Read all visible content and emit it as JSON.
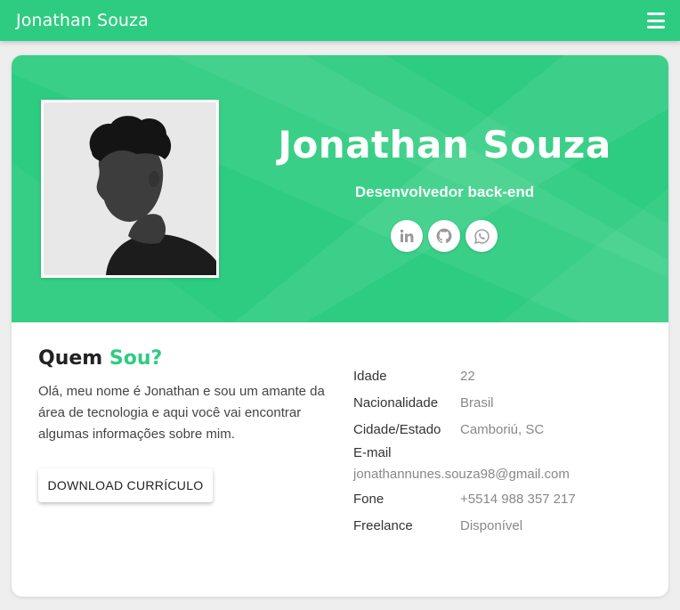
{
  "navbar": {
    "brand": "Jonathan Souza",
    "menu_icon": "hamburger-menu-icon"
  },
  "hero": {
    "name": "Jonathan Souza",
    "role": "Desenvolvedor back-end",
    "avatar_alt": "profile-photo",
    "socials": [
      {
        "name": "linkedin",
        "icon": "linkedin-icon"
      },
      {
        "name": "github",
        "icon": "github-icon"
      },
      {
        "name": "whatsapp",
        "icon": "whatsapp-icon"
      }
    ]
  },
  "about": {
    "title_main": "Quem",
    "title_accent": "Sou?",
    "text": "Olá, meu nome é Jonathan e sou um amante da área de tecnologia e aqui você vai encontrar algumas informações sobre mim.",
    "download_label": "DOWNLOAD CURRÍCULO"
  },
  "info": {
    "age_label": "Idade",
    "age_value": "22",
    "nationality_label": "Nacionalidade",
    "nationality_value": "Brasil",
    "city_label": "Cidade/Estado",
    "city_value": "Camboriú, SC",
    "email_label": "E-mail",
    "email_value": "jonathannunes.souza98@gmail.com",
    "phone_label": "Fone",
    "phone_value": "+5514 988 357 217",
    "freelance_label": "Freelance",
    "freelance_value": "Disponível"
  },
  "colors": {
    "accent": "#2ecc80",
    "background": "#eeeeee"
  }
}
